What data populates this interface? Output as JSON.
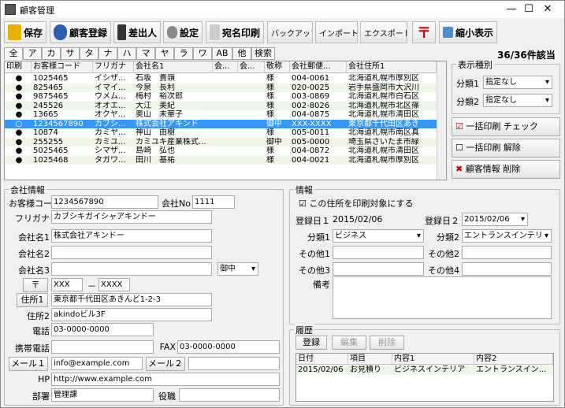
{
  "window": {
    "title": "顧客管理",
    "min": "—",
    "max": "☐",
    "close": "✕"
  },
  "toolbar": {
    "save": "保存",
    "register": "顧客登録",
    "sender": "差出人",
    "settings": "設定",
    "print": "宛名印刷",
    "backup": "バックアップ",
    "import": "インポート",
    "export": "エクスポート",
    "postal": "〒",
    "shrink": "縮小表示"
  },
  "tabs": [
    "全",
    "ア",
    "カ",
    "サ",
    "タ",
    "ナ",
    "ハ",
    "マ",
    "ヤ",
    "ラ",
    "ワ",
    "AB",
    "他",
    "検索"
  ],
  "count_label": "36/36件該当",
  "grid": {
    "headers": [
      "印刷",
      "お客様コード",
      "フリガナ",
      "会社名1",
      "会...",
      "会...",
      "敬称",
      "会社郵便...",
      "会社住所1"
    ],
    "rows": [
      [
        "●",
        "1025465",
        "イシザ...",
        "石坂　貴嶺",
        "",
        "",
        "様",
        "004-0061",
        "北海道札幌市厚別区"
      ],
      [
        "●",
        "825465",
        "イマイ...",
        "今泉　長利",
        "",
        "",
        "様",
        "020-0025",
        "岩手県盛岡市大沢川"
      ],
      [
        "●",
        "9875465",
        "ウメム...",
        "梅村　裕次郎",
        "",
        "",
        "様",
        "003-0869",
        "北海道札幌市白石区"
      ],
      [
        "●",
        "245526",
        "オオエ...",
        "大江　美紀",
        "",
        "",
        "様",
        "002-8026",
        "北海道札幌市北区篠"
      ],
      [
        "●",
        "13665",
        "オクヤ...",
        "奥山　未華子",
        "",
        "",
        "様",
        "004-0875",
        "北海道札幌市清田区"
      ],
      [
        "○",
        "1234567890",
        "カブシ...",
        "株式会社アキンド",
        "",
        "",
        "御中",
        "XXX-XXXX",
        "東京都千代田区あき"
      ],
      [
        "●",
        "10874",
        "カミヤ...",
        "神山　由樹",
        "",
        "",
        "様",
        "005-0011",
        "北海道札幌市南区真"
      ],
      [
        "●",
        "255255",
        "カミユ...",
        "カミユキ産業株式...",
        "",
        "",
        "御中",
        "005-0000",
        "埼玉県さいたま市緑"
      ],
      [
        "●",
        "5025465",
        "シマザ...",
        "島崎　弘也",
        "",
        "",
        "様",
        "004-0872",
        "北海道札幌市清田区"
      ],
      [
        "●",
        "1025468",
        "タガワ...",
        "田川　基祐",
        "",
        "",
        "様",
        "004-0021",
        "北海道札幌市厚別区"
      ]
    ]
  },
  "display_type": {
    "title": "表示種別",
    "cat1_label": "分類1",
    "cat1_value": "指定なし",
    "cat2_label": "分類2",
    "cat2_value": "指定なし"
  },
  "side_buttons": {
    "print_check": "一括印刷 チェック",
    "print_release": "一括印刷 解除",
    "delete": "顧客情報 削除"
  },
  "company": {
    "title": "会社情報",
    "code_label": "お客様コード",
    "code": "1234567890",
    "no_label": "会社No",
    "no": "1111",
    "furigana_label": "フリガナ",
    "furigana": "カブシキガイシャアキンドー",
    "name1_label": "会社名1",
    "name1": "株式会社アキンドー",
    "name2_label": "会社名2",
    "name2": "",
    "name3_label": "会社名3",
    "name3": "",
    "honorific": "御中",
    "postal_btn": "〒",
    "postal1": "XXX",
    "postal_sep": "－",
    "postal2": "XXXX",
    "addr1_btn": "住所1",
    "addr1": "東京都千代田区あきんど1-2-3",
    "addr2_label": "住所2",
    "addr2": "akindoビル3F",
    "tel_label": "電話",
    "tel": "03-0000-0000",
    "mobile_label": "携帯電話",
    "mobile": "",
    "fax_label": "FAX",
    "fax": "03-0000-0000",
    "mail1_btn": "メール１",
    "mail1": "info@example.com",
    "mail2_btn": "メール２",
    "mail2": "",
    "hp_label": "HP",
    "hp": "http://www.example.com",
    "dept_label": "部署",
    "dept": "管理課",
    "role_label": "役職",
    "role": ""
  },
  "info": {
    "title": "情報",
    "print_check": "この住所を印刷対象にする",
    "reg1_label": "登録日１",
    "reg1": "2015/02/06",
    "reg2_label": "登録日２",
    "reg2": "2015/02/06",
    "cat1_label": "分類1",
    "cat1": "ビジネス",
    "cat2_label": "分類2",
    "cat2": "エントランスインテリ",
    "other1_label": "その他1",
    "other1": "",
    "other2_label": "その他2",
    "other2": "",
    "other3_label": "その他3",
    "other3": "",
    "other4_label": "その他4",
    "other4": "",
    "note_label": "備考",
    "note": ""
  },
  "history": {
    "title": "履歴",
    "register": "登録",
    "edit": "編集",
    "delete": "削除",
    "headers": [
      "日付",
      "項目",
      "内容1",
      "内容2"
    ],
    "rows": [
      [
        "2015/02/06",
        "お見積り",
        "ビジネスインテリア",
        "エントランスイン..."
      ]
    ]
  }
}
